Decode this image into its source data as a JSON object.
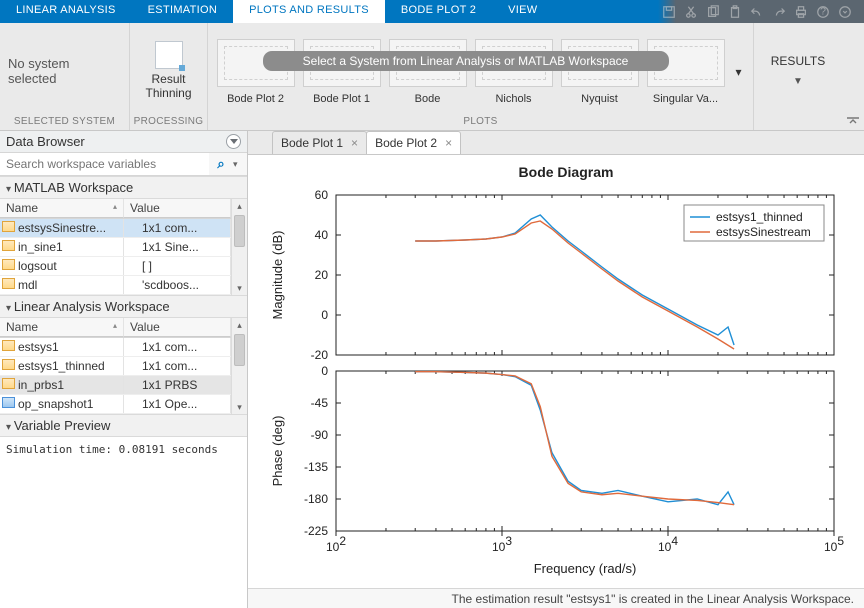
{
  "ribbon": {
    "tabs": [
      "LINEAR ANALYSIS",
      "ESTIMATION",
      "PLOTS AND RESULTS",
      "BODE PLOT 2",
      "VIEW"
    ],
    "active_index": 2
  },
  "toolstrip": {
    "selected_system": {
      "label": "No system selected",
      "group": "SELECTED SYSTEM"
    },
    "processing": {
      "btn": "Result Thinning",
      "group": "PROCESSING"
    },
    "plots": {
      "banner": "Select a System from Linear Analysis or MATLAB Workspace",
      "thumbs": [
        "Bode Plot 2",
        "Bode Plot 1",
        "Bode",
        "Nichols",
        "Nyquist",
        "Singular Va..."
      ],
      "group": "PLOTS"
    },
    "results": {
      "label": "RESULTS"
    }
  },
  "side": {
    "title": "Data Browser",
    "search_placeholder": "Search workspace variables",
    "ws_matlab": {
      "title": "MATLAB Workspace",
      "columns": [
        "Name",
        "Value"
      ],
      "rows": [
        {
          "name": "estsysSinestre...",
          "value": "1x1 com...",
          "sel": true,
          "icon": "yellow"
        },
        {
          "name": "in_sine1",
          "value": "1x1 Sine...",
          "icon": "yellow"
        },
        {
          "name": "logsout",
          "value": "[ ]",
          "icon": "yellow"
        },
        {
          "name": "mdl",
          "value": "'scdboos...",
          "icon": "yellow"
        }
      ]
    },
    "ws_linear": {
      "title": "Linear Analysis Workspace",
      "columns": [
        "Name",
        "Value"
      ],
      "rows": [
        {
          "name": "estsys1",
          "value": "1x1 com...",
          "icon": "yellow"
        },
        {
          "name": "estsys1_thinned",
          "value": "1x1 com...",
          "icon": "yellow"
        },
        {
          "name": "in_prbs1",
          "value": "1x1 PRBS",
          "sel2": true,
          "icon": "yellow"
        },
        {
          "name": "op_snapshot1",
          "value": "1x1 Ope...",
          "icon": "blue"
        }
      ]
    },
    "preview": {
      "title": "Variable Preview",
      "text": "Simulation time: 0.08191 seconds"
    }
  },
  "docs": {
    "tabs": [
      {
        "label": "Bode Plot 1",
        "active": false
      },
      {
        "label": "Bode Plot 2",
        "active": true
      }
    ]
  },
  "status": "The estimation result \"estsys1\" is created in the Linear Analysis Workspace.",
  "chart_data": {
    "type": "bode",
    "title": "Bode Diagram",
    "xlabel": "Frequency  (rad/s)",
    "xlim": [
      100,
      100000
    ],
    "xticks": [
      100,
      1000,
      10000,
      100000
    ],
    "xtick_labels": [
      "10^2",
      "10^3",
      "10^4",
      "10^5"
    ],
    "magnitude": {
      "ylabel": "Magnitude (dB)",
      "ylim": [
        -20,
        60
      ],
      "yticks": [
        -20,
        0,
        20,
        40,
        60
      ]
    },
    "phase": {
      "ylabel": "Phase (deg)",
      "ylim": [
        -225,
        0
      ],
      "yticks": [
        -225,
        -180,
        -135,
        -90,
        -45,
        0
      ]
    },
    "legend": [
      "estsys1_thinned",
      "estsysSinestream"
    ],
    "colors": {
      "estsys1_thinned": "#1f8fd6",
      "estsysSinestream": "#e06a3c"
    },
    "series": [
      {
        "name": "estsys1_thinned",
        "freq": [
          300,
          400,
          600,
          800,
          1000,
          1200,
          1500,
          1700,
          2000,
          2500,
          3000,
          4000,
          5000,
          7000,
          10000,
          15000,
          20000,
          23000,
          25000
        ],
        "mag": [
          37,
          37,
          37.5,
          38,
          39,
          41,
          48,
          50,
          44,
          37,
          32,
          24,
          18,
          10,
          3,
          -5,
          -10,
          -6,
          -15
        ],
        "phase": [
          -1,
          -1,
          -2,
          -3,
          -5,
          -8,
          -20,
          -55,
          -115,
          -155,
          -168,
          -172,
          -168,
          -176,
          -184,
          -180,
          -188,
          -170,
          -188
        ]
      },
      {
        "name": "estsysSinestream",
        "freq": [
          300,
          400,
          600,
          800,
          1000,
          1200,
          1500,
          1700,
          2000,
          2500,
          3000,
          4000,
          5000,
          7000,
          10000,
          15000,
          20000,
          25000
        ],
        "mag": [
          37,
          37,
          37.5,
          38,
          39,
          40.5,
          46,
          47,
          43,
          36,
          31,
          23,
          17,
          9,
          2,
          -6,
          -12,
          -17
        ],
        "phase": [
          -1,
          -1,
          -2,
          -3,
          -5,
          -7,
          -18,
          -50,
          -120,
          -158,
          -170,
          -174,
          -172,
          -176,
          -180,
          -182,
          -185,
          -188
        ]
      }
    ]
  }
}
